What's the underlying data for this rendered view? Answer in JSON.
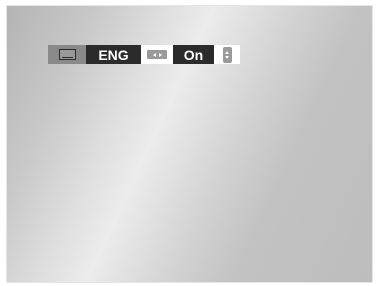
{
  "screen": {
    "background_color": "#cfcfcf"
  },
  "osd": {
    "subtitle_icon": "subtitle-icon",
    "language_value": "ENG",
    "language_adjust_icon": "left-right-arrows-icon",
    "state_value": "On",
    "state_adjust_icon": "up-down-arrows-icon"
  },
  "colors": {
    "highlight_dark": "#2b2b2b",
    "icon_cell": "#8a8a8a",
    "text": "#ffffff"
  }
}
